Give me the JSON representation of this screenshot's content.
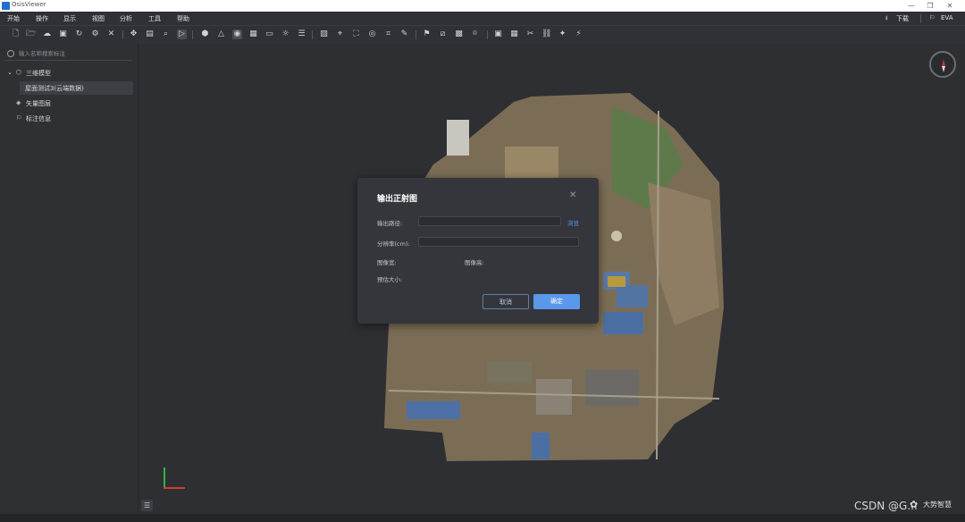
{
  "window": {
    "title": "OsisViewer",
    "minimize": "—",
    "restore": "❐",
    "close": "✕"
  },
  "menu": {
    "items": [
      "开始",
      "操作",
      "显示",
      "视图",
      "分析",
      "工具",
      "帮助"
    ]
  },
  "header_right": {
    "download_label": "下载",
    "user_label": "EVA"
  },
  "sidebar": {
    "search_placeholder": "输入名称搜索标注",
    "items": [
      {
        "label": "三维模型",
        "expanded": true
      },
      {
        "label": "屋面测试3(云端数据)",
        "selected": true
      },
      {
        "label": "矢量图层"
      },
      {
        "label": "标注信息"
      }
    ]
  },
  "toolbar_icons": [
    "new-file-icon",
    "open-folder-icon",
    "cloud-icon",
    "save-icon",
    "refresh-icon",
    "settings-icon",
    "close-icon",
    "move-icon",
    "document-icon",
    "search-icon",
    "select-icon",
    "model-icon",
    "measure-icon",
    "layer-icon",
    "grid-icon",
    "screen-icon",
    "light-icon",
    "list-icon",
    "image-icon",
    "focus-icon",
    "fullscreen-icon",
    "camera-icon",
    "crop-icon",
    "pen-icon",
    "flag-icon",
    "split-icon",
    "box-icon",
    "pin-icon",
    "window-icon",
    "table-icon",
    "cut-icon",
    "link-icon",
    "magic-icon"
  ],
  "dialog": {
    "title": "输出正射图",
    "output_path_label": "输出路径:",
    "output_path_value": "",
    "browse_label": "浏览",
    "resolution_label": "分辨率(cm):",
    "resolution_value": "",
    "image_width_label": "图像宽:",
    "image_height_label": "图像高:",
    "file_size_label": "预估大小:",
    "cancel_label": "取消",
    "ok_label": "确定"
  },
  "watermark": {
    "text": "CSDN @G...",
    "logo_text": "大势智慧"
  },
  "colors": {
    "accent": "#5b97ea",
    "link": "#4e9df5",
    "bg": "#2e2f33",
    "panel": "#35363b"
  }
}
